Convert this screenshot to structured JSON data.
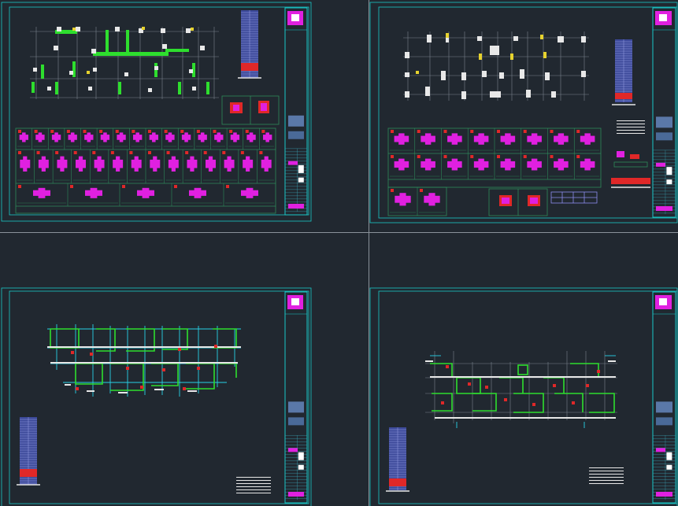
{
  "app": {
    "background": "#212830"
  },
  "colors": {
    "frame": "#19c8c8",
    "grid": "#7a828c",
    "wall_green": "#2ede2e",
    "wall_white": "#e8e8e8",
    "dim_gray": "#9aa2aa",
    "accent_yellow": "#e6d22e",
    "rebar_red": "#e02828",
    "column_magenta": "#e020e0",
    "stair_blue": "#8c8cee",
    "axis_cyan": "#28d2e6"
  },
  "sheets": [
    {
      "id": "sheet-1",
      "content": "column-grid-plan-with-detail-tables"
    },
    {
      "id": "sheet-2",
      "content": "column-grid-plan-with-detail-tables"
    },
    {
      "id": "sheet-3",
      "content": "floor-plan-with-wall-layout"
    },
    {
      "id": "sheet-4",
      "content": "floor-plan-with-wall-layout"
    }
  ],
  "icons": {
    "elevation_key": "building-elevation-key-icon",
    "title_block": "title-block-stamp"
  }
}
